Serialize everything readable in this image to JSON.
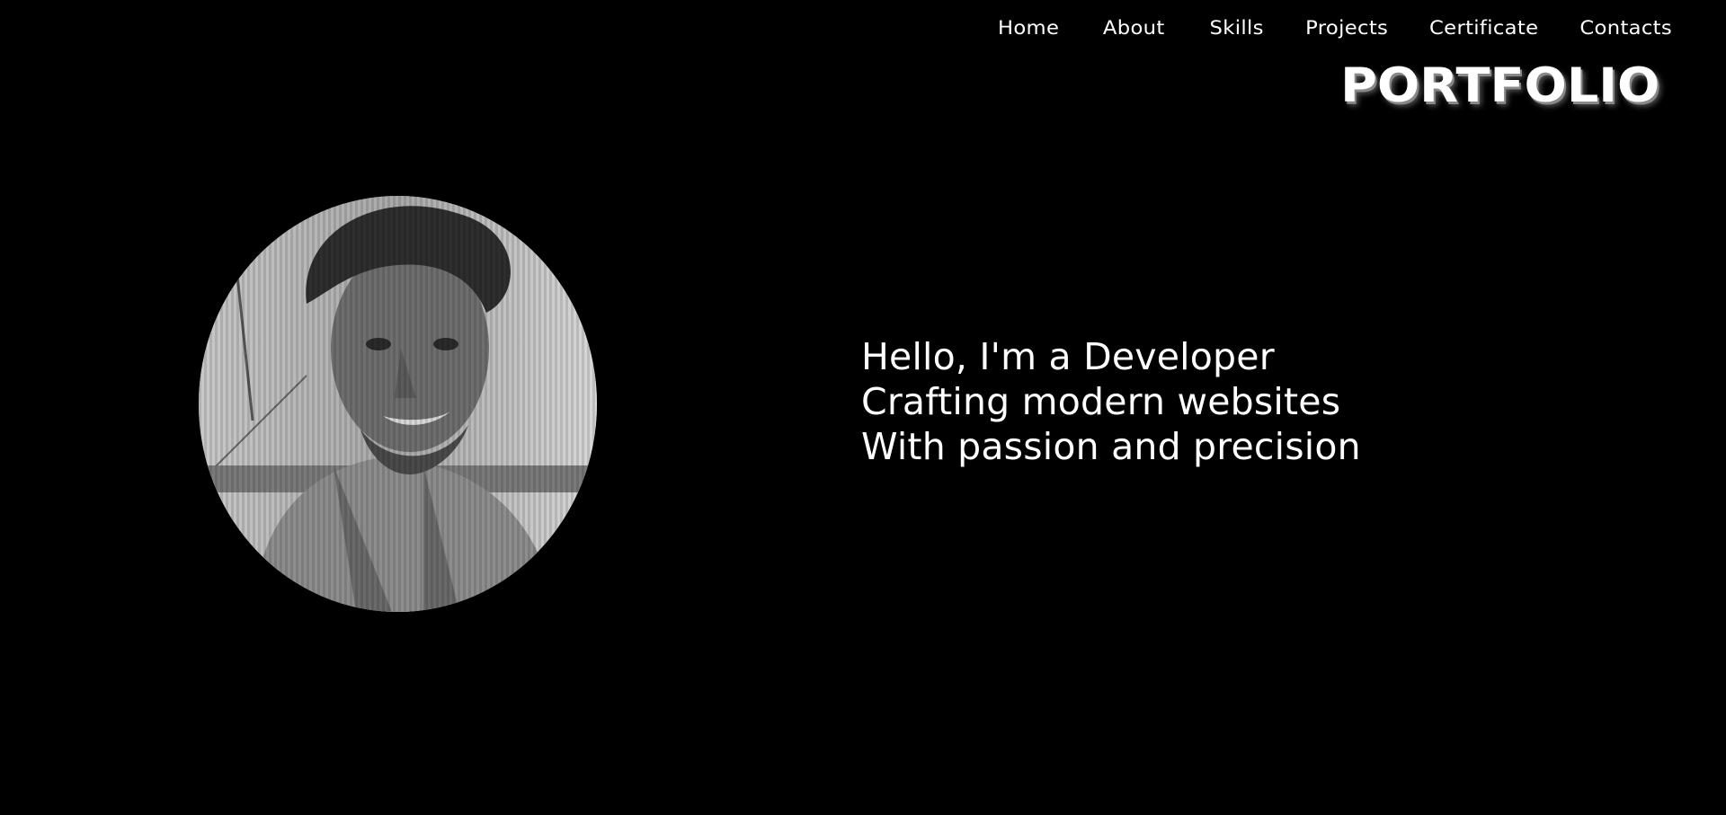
{
  "nav": {
    "items": [
      {
        "label": "Home"
      },
      {
        "label": "About"
      },
      {
        "label": "Skills"
      },
      {
        "label": "Projects"
      },
      {
        "label": "Certificate"
      },
      {
        "label": "Contacts"
      }
    ]
  },
  "brand": {
    "title": "PORTFOLIO"
  },
  "hero": {
    "lines": [
      "Hello, I'm a Developer",
      "Crafting modern websites",
      "With passion and precision"
    ]
  },
  "profile": {
    "image_icon": "profile-photo"
  },
  "colors": {
    "background": "#000000",
    "text": "#ffffff",
    "title_shadow": "#888888"
  }
}
